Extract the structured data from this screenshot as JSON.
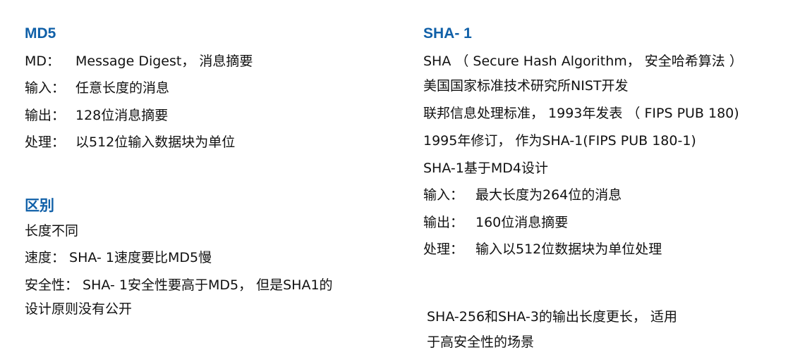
{
  "left": {
    "md5_heading": "MD5",
    "md5_lines": [
      {
        "key": "MD：",
        "value": "Message Digest， 消息摘要"
      },
      {
        "key": "输入：",
        "value": "任意长度的消息"
      },
      {
        "key": "输出：",
        "value": "128位消息摘要"
      },
      {
        "key": "处理：",
        "value": "以512位输入数据块为单位"
      }
    ],
    "diff_heading": "区别",
    "diff_lines": [
      "长度不同",
      "速度： SHA- 1速度要比MD5慢",
      "安全性： SHA- 1安全性要高于MD5， 但是SHA1的",
      "设计原则没有公开"
    ]
  },
  "right": {
    "sha1_heading": "SHA- 1",
    "sha1_lines": [
      "SHA （ Secure Hash Algorithm， 安全哈希算法 ）",
      "美国国家标准技术研究所NIST开发",
      "联邦信息处理标准， 1993年发表 （ FIPS PUB 180)",
      "1995年修订， 作为SHA-1(FIPS PUB 180-1)",
      "SHA-1基于MD4设计"
    ],
    "sha1_kv": [
      {
        "key": "输入：",
        "value": "最大长度为264位的消息"
      },
      {
        "key": "输出：",
        "value": "160位消息摘要"
      },
      {
        "key": "处理：",
        "value": "输入以512位数据块为单位处理"
      }
    ],
    "note_lines": [
      "SHA-256和SHA-3的输出长度更长， 适用",
      "于高安全性的场景"
    ]
  },
  "colors": {
    "heading": "#1060a8",
    "text": "#111111"
  }
}
